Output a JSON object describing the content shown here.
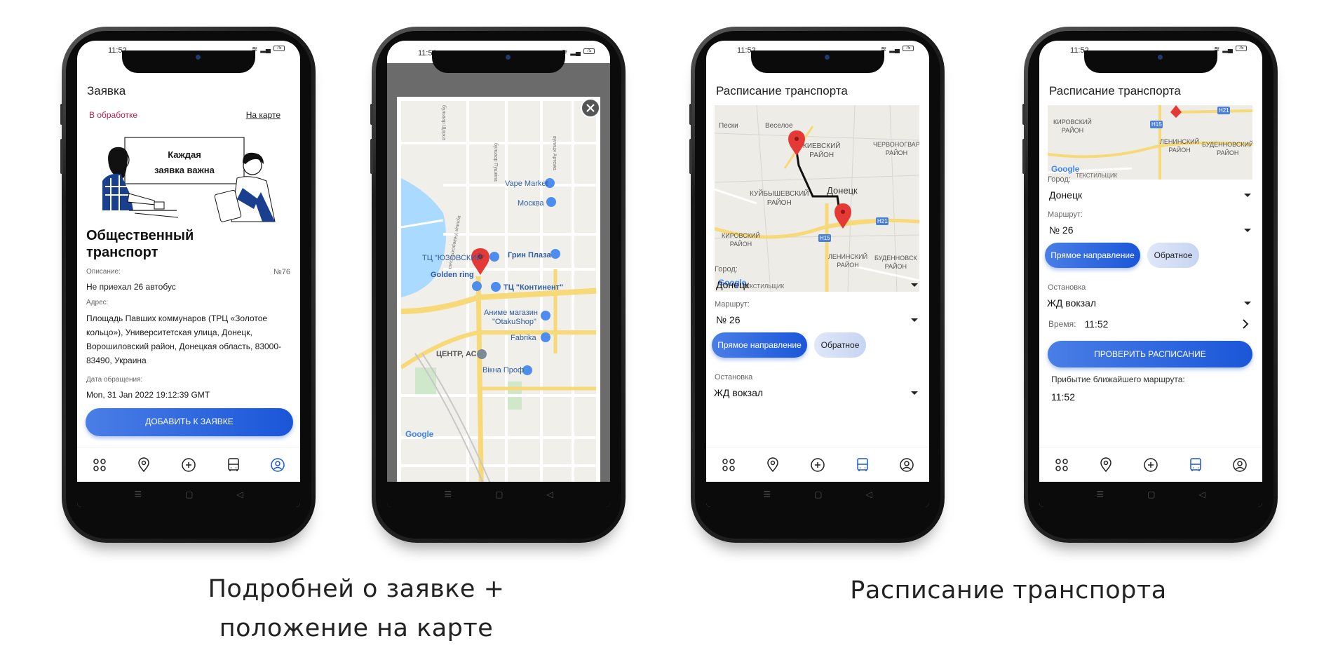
{
  "status_time": "11:52",
  "battery": "75",
  "captions": {
    "left_line1": "Подробней о заявке +",
    "left_line2": "положение на карте",
    "right": "Расписание транспорта"
  },
  "phone1": {
    "title": "Заявка",
    "status": "В обработке",
    "map_link": "На карте",
    "illustration_text_line1": "Каждая",
    "illustration_text_line2": "заявка важна",
    "heading": "Общественный транспорт",
    "description_label": "Описание:",
    "number": "№76",
    "description": "Не приехал 26 автобус",
    "address_label": "Адрес:",
    "address": "Площадь Павших коммунаров (ТРЦ «Золотое кольцо»), Университетская улица, Донецк, Ворошиловский район, Донецкая область, 83000-83490, Украина",
    "date_label": "Дата обращения:",
    "date": "Mon, 31 Jan 2022 19:12:39 GMT",
    "add_button": "ДОБАВИТЬ К ЗАЯВКЕ"
  },
  "phone2": {
    "map_labels": {
      "vape": "Vape Market",
      "moskva": "Москва",
      "grin": "Грин Плаза",
      "yuz": "ТЦ \"ЮЗОВСКИЙ\"",
      "golden": "Golden ring",
      "kontinent": "ТЦ \"Континент\"",
      "anime1": "Аниме магазин",
      "anime2": "\"OtakuShop\"",
      "fabrika": "Fabrika",
      "centr": "ЦЕНТР, АС",
      "vikna": "Вікна Проф",
      "street1": "бульвар Пушкіна",
      "street2": "вулиця Артема",
      "street3": "бульвар Щорса",
      "street4": "вулиця Університетська"
    },
    "google": "Google"
  },
  "phone3": {
    "title": "Расписание транспорта",
    "map_labels": {
      "peski": "Пески",
      "veseloe": "Веселое",
      "kiev1": "КИЕВСКИЙ",
      "kiev2": "РАЙОН",
      "cherv1": "ЧЕРВОНОГВАР",
      "cherv2": "РАЙОН",
      "kuib1": "КУЙБЫШЕВСКИЙ",
      "kuib2": "РАЙОН",
      "donetsk": "Донецк",
      "kir1": "КИРОВСКИЙ",
      "kir2": "РАЙОН",
      "len1": "ЛЕНИНСКИЙ",
      "len2": "РАЙОН",
      "bud1": "БУДЕННОВСК",
      "bud2": "РАЙОН",
      "h15": "H15",
      "h21": "H21",
      "tekstil": "ТЕКСТИЛЬЩИК"
    },
    "google": "Google",
    "city_label": "Город:",
    "city": "Донецк",
    "route_label": "Маршрут:",
    "route": "№ 26",
    "forward": "Прямое направление",
    "backward": "Обратное",
    "stop_label": "Остановка",
    "stop": "ЖД вокзал"
  },
  "phone4": {
    "title": "Расписание транспорта",
    "map_labels": {
      "kir1": "КИРОВСКИЙ",
      "kir2": "РАЙОН",
      "h15": "H15",
      "h21": "H21",
      "len1": "ЛЕНИНСКИЙ",
      "len2": "РАЙОН",
      "bud1": "БУДЕННОВСКИЙ",
      "bud2": "РАЙОН",
      "tekstil": "ТЕКСТИЛЬЩИК"
    },
    "google": "Google",
    "city_label": "Город:",
    "city": "Донецк",
    "route_label": "Маршрут:",
    "route": "№ 26",
    "forward": "Прямое направление",
    "backward": "Обратное",
    "stop_label": "Остановка",
    "stop": "ЖД вокзал",
    "time_label": "Время:",
    "time": "11:52",
    "check_button": "ПРОВЕРИТЬ РАСПИСАНИЕ",
    "arrival_label": "Прибытие ближайшего маршрута:",
    "arrival": "11:52"
  },
  "colors": {
    "accent": "#1a56d8",
    "status_red": "#b0244a",
    "map_water": "#aadaff",
    "pin": "#e53935"
  },
  "icons": [
    "apps-icon",
    "location-icon",
    "add-circle-icon",
    "bus-icon",
    "account-icon",
    "close-icon",
    "chevron-right-icon"
  ]
}
